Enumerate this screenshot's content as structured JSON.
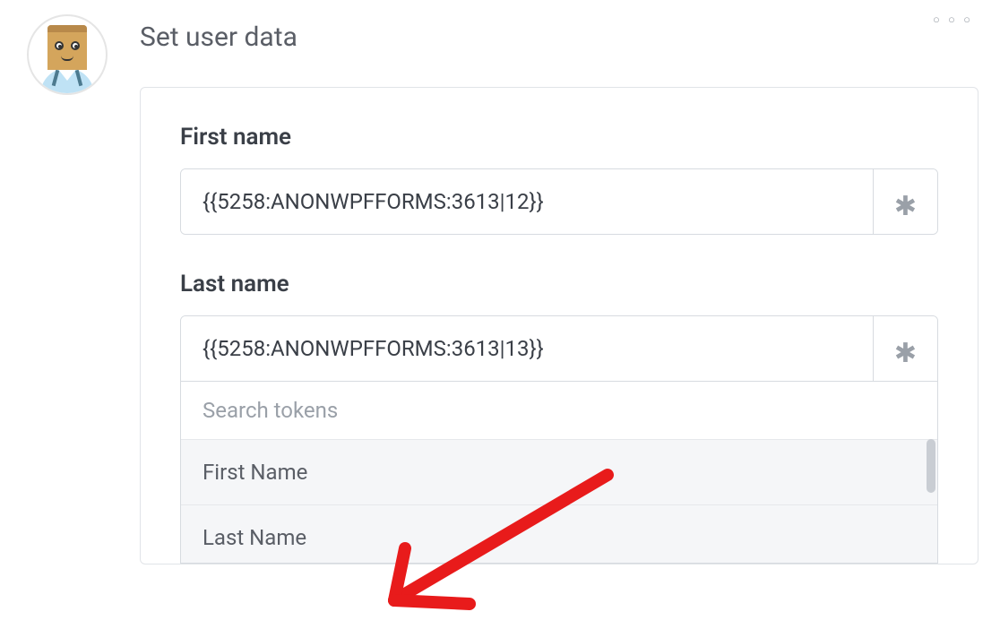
{
  "section": {
    "title": "Set user data"
  },
  "fields": {
    "first_name": {
      "label": "First name",
      "value": "{{5258:ANONWPFFORMS:3613|12}}"
    },
    "last_name": {
      "label": "Last name",
      "value": "{{5258:ANONWPFFORMS:3613|13}}"
    }
  },
  "token_dropdown": {
    "search_placeholder": "Search tokens",
    "items": [
      "First Name",
      "Last Name"
    ]
  }
}
